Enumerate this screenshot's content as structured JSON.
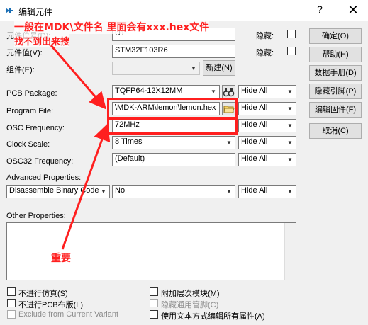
{
  "window": {
    "title": "编辑元件",
    "help_glyph": "?",
    "close_glyph": "✕"
  },
  "fields": {
    "designator_label": "元件位号(D):",
    "designator_value": "U1",
    "value_label": "元件值(V):",
    "value_value": "STM32F103R6",
    "group_label": "组件(E):",
    "group_value": "",
    "new_button": "新建(N)",
    "hide_label_1": "隐藏:",
    "hide_label_2": "隐藏:"
  },
  "properties": [
    {
      "label": "PCB Package:",
      "value": "TQFP64-12X12MM",
      "vis": "Hide All"
    },
    {
      "label": "Program File:",
      "value": "\\MDK-ARM\\lemon\\lemon.hex",
      "vis": "Hide All"
    },
    {
      "label": "OSC Frequency:",
      "value": "72MHz",
      "vis": "Hide All"
    },
    {
      "label": "Clock Scale:",
      "value": "8 Times",
      "vis": "Hide All"
    },
    {
      "label": "OSC32 Frequency:",
      "value": "(Default)",
      "vis": "Hide All"
    }
  ],
  "advanced": {
    "label": "Advanced Properties:",
    "name": "Disassemble Binary Code",
    "value": "No",
    "vis": "Hide All"
  },
  "other": {
    "label": "Other Properties:",
    "text": ""
  },
  "buttons": [
    "确定(O)",
    "帮助(H)",
    "数据手册(D)",
    "隐藏引脚(P)",
    "编辑固件(F)",
    "取消(C)"
  ],
  "checkboxes_left": [
    {
      "label": "不进行仿真(S)",
      "checked": false,
      "disabled": false
    },
    {
      "label": "不进行PCB布版(L)",
      "checked": false,
      "disabled": false
    },
    {
      "label": "Exclude from Current Variant",
      "checked": false,
      "disabled": true
    }
  ],
  "checkboxes_right": [
    {
      "label": "附加层次模块(M)",
      "checked": false,
      "disabled": false
    },
    {
      "label": "隐藏通用管脚(C)",
      "checked": false,
      "disabled": true
    },
    {
      "label": "使用文本方式编辑所有属性(A)",
      "checked": false,
      "disabled": false
    }
  ],
  "annotations": {
    "line1": "一般在MDK\\文件名  里面会有xxx.hex文件",
    "line2": "找不到出来搜",
    "important": "重要"
  },
  "colors": {
    "annotation": "#ff1f1f"
  }
}
